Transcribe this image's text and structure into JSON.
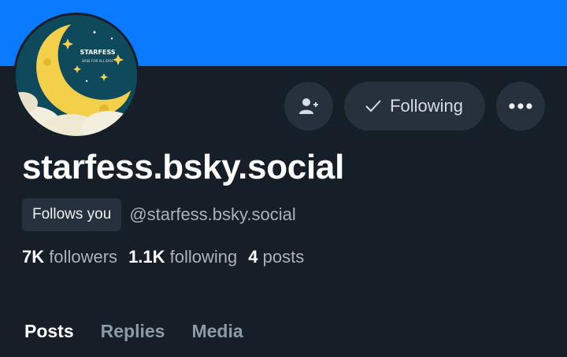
{
  "profile": {
    "display_name": "starfess.bsky.social",
    "handle": "@starfess.bsky.social",
    "follows_you_badge": "Follows you",
    "avatar": {
      "brand_text": "STARFESS",
      "tagline": "BASE FOR ALL IDOL"
    }
  },
  "actions": {
    "add_user_icon": "person-plus-icon",
    "following_label": "Following",
    "check_icon": "checkmark-icon",
    "more_icon": "ellipsis-icon"
  },
  "stats": {
    "followers_count": "7K",
    "followers_label": "followers",
    "following_count": "1.1K",
    "following_label": "following",
    "posts_count": "4",
    "posts_label": "posts"
  },
  "tabs": [
    {
      "label": "Posts",
      "active": true
    },
    {
      "label": "Replies",
      "active": false
    },
    {
      "label": "Media",
      "active": false
    }
  ],
  "colors": {
    "banner": "#0a7aff",
    "background": "#161e27",
    "button_bg": "#27313d"
  }
}
